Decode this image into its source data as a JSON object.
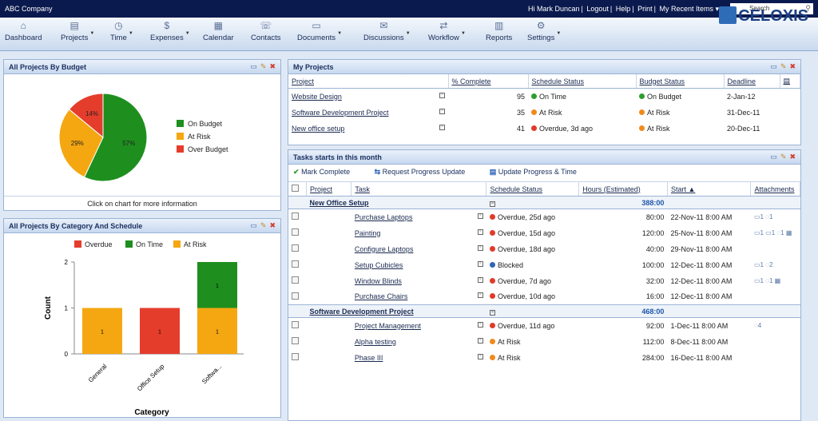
{
  "topbar": {
    "company": "ABC Company",
    "greeting": "Hi Mark Duncan",
    "logout": "Logout",
    "help": "Help",
    "print": "Print",
    "recent": "My Recent Items ▾",
    "search_placeholder": "Search"
  },
  "nav": [
    {
      "label": "Dashboard",
      "icon": "home-icon"
    },
    {
      "label": "Projects",
      "icon": "projects-icon"
    },
    {
      "label": "Time",
      "icon": "clock-icon"
    },
    {
      "label": "Expenses",
      "icon": "expenses-icon"
    },
    {
      "label": "Calendar",
      "icon": "calendar-icon"
    },
    {
      "label": "Contacts",
      "icon": "contacts-icon"
    },
    {
      "label": "Documents",
      "icon": "documents-icon"
    },
    {
      "label": "Discussions",
      "icon": "discussions-icon"
    },
    {
      "label": "Workflow",
      "icon": "workflow-icon"
    },
    {
      "label": "Reports",
      "icon": "reports-icon"
    },
    {
      "label": "Settings",
      "icon": "settings-icon"
    }
  ],
  "logo": "CELOXIS",
  "budget_panel": {
    "title": "All Projects By Budget",
    "footer": "Click on chart for more information"
  },
  "category_panel": {
    "title": "All Projects By Category And Schedule"
  },
  "my_projects": {
    "title": "My Projects",
    "columns": [
      "Project",
      "% Complete",
      "Schedule Status",
      "Budget Status",
      "Deadline"
    ],
    "rows": [
      {
        "project": "Website Design",
        "pct": "95",
        "schedule": "On Time",
        "schedule_color": "#2e9e2e",
        "budget": "On Budget",
        "budget_color": "#2e9e2e",
        "deadline": "2-Jan-12"
      },
      {
        "project": "Software Development Project",
        "pct": "35",
        "schedule": "At Risk",
        "schedule_color": "#f08a1c",
        "budget": "At Risk",
        "budget_color": "#f08a1c",
        "deadline": "31-Dec-11"
      },
      {
        "project": "New office setup",
        "pct": "41",
        "schedule": "Overdue, 3d ago",
        "schedule_color": "#e03a2a",
        "budget": "At Risk",
        "budget_color": "#f08a1c",
        "deadline": "20-Dec-11"
      }
    ]
  },
  "tasks": {
    "title": "Tasks starts in this month",
    "actions": [
      "Mark Complete",
      "Request Progress Update",
      "Update Progress & Time"
    ],
    "columns": [
      "Project",
      "Task",
      "Schedule Status",
      "Hours (Estimated)",
      "Start ▲",
      "Attachments"
    ],
    "groups": [
      {
        "name": "New Office Setup",
        "hours": "388:00",
        "rows": [
          {
            "task": "Purchase Laptops",
            "status": "Overdue, 25d ago",
            "color": "#e03a2a",
            "hours": "80:00",
            "start": "22-Nov-11 8:00 AM",
            "att": "▭1 ◌1"
          },
          {
            "task": "Painting",
            "status": "Overdue, 15d ago",
            "color": "#e03a2a",
            "hours": "120:00",
            "start": "25-Nov-11 8:00 AM",
            "att": "▭1 ▭1 ◌1 ▦"
          },
          {
            "task": "Configure Laptops",
            "status": "Overdue, 18d ago",
            "color": "#e03a2a",
            "hours": "40:00",
            "start": "29-Nov-11 8:00 AM",
            "att": ""
          },
          {
            "task": "Setup Cubicles",
            "status": "Blocked",
            "color": "#2f64b8",
            "hours": "100:00",
            "start": "12-Dec-11 8:00 AM",
            "att": "▭1 ◌2"
          },
          {
            "task": "Window Blinds",
            "status": "Overdue, 7d ago",
            "color": "#e03a2a",
            "hours": "32:00",
            "start": "12-Dec-11 8:00 AM",
            "att": "▭1 ◌1 ▦"
          },
          {
            "task": "Purchase Chairs",
            "status": "Overdue, 10d ago",
            "color": "#e03a2a",
            "hours": "16:00",
            "start": "12-Dec-11 8:00 AM",
            "att": ""
          }
        ]
      },
      {
        "name": "Software Development Project",
        "hours": "468:00",
        "rows": [
          {
            "task": "Project Management",
            "status": "Overdue, 11d ago",
            "color": "#e03a2a",
            "hours": "92:00",
            "start": "1-Dec-11 8:00 AM",
            "att": "◌4"
          },
          {
            "task": "Alpha testing",
            "status": "At Risk",
            "color": "#f08a1c",
            "hours": "112:00",
            "start": "8-Dec-11 8:00 AM",
            "att": ""
          },
          {
            "task": "Phase III",
            "status": "At Risk",
            "color": "#f08a1c",
            "hours": "284:00",
            "start": "16-Dec-11 8:00 AM",
            "att": ""
          }
        ]
      }
    ]
  },
  "chart_data": [
    {
      "type": "pie",
      "title": "All Projects By Budget",
      "slices": [
        {
          "label": "On Budget",
          "value": 57,
          "display": "57%",
          "color": "#1e8f1e"
        },
        {
          "label": "At Risk",
          "value": 29,
          "display": "29%",
          "color": "#f5a712"
        },
        {
          "label": "Over Budget",
          "value": 14,
          "display": "14%",
          "color": "#e53d2b"
        }
      ],
      "legend_position": "right"
    },
    {
      "type": "bar",
      "stacked": true,
      "title": "All Projects By Category And Schedule",
      "xlabel": "Category",
      "ylabel": "Count",
      "categories": [
        "General",
        "Office Setup",
        "Softwa..."
      ],
      "ylim": [
        0,
        2
      ],
      "yticks": [
        0,
        1,
        2
      ],
      "legend_position": "top",
      "series": [
        {
          "name": "Overdue",
          "color": "#e53d2b",
          "values": [
            0,
            1,
            0
          ]
        },
        {
          "name": "On Time",
          "color": "#1e8f1e",
          "values": [
            0,
            0,
            1
          ]
        },
        {
          "name": "At Risk",
          "color": "#f5a712",
          "values": [
            1,
            0,
            1
          ]
        }
      ]
    }
  ]
}
